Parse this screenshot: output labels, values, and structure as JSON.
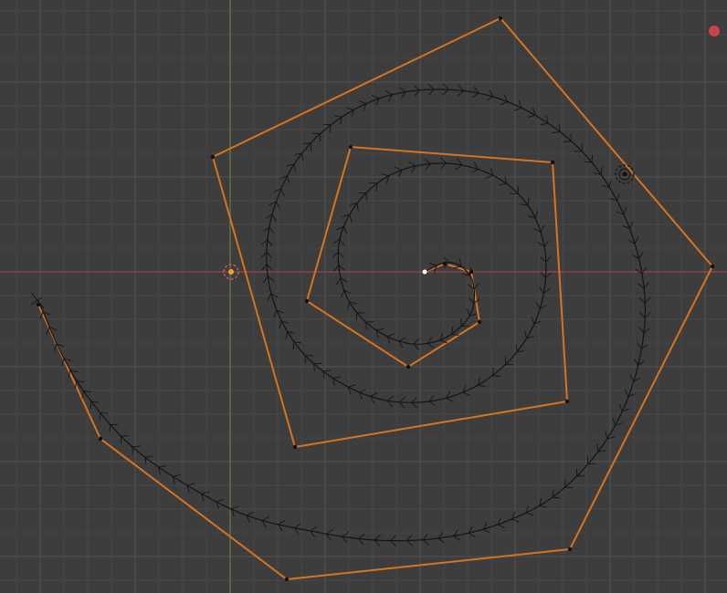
{
  "viewport": {
    "background_color": "#3d3d3d",
    "grid_minor_color": "#464646",
    "grid_major_color": "#525252",
    "x_axis_color": "#a84a4a",
    "y_axis_color": "#6b8a3a",
    "control_polygon_color": "#d7741f",
    "curve_color": "#141414",
    "vertex_color": "#111111",
    "active_vertex_color": "#ffffff",
    "origin_marker_color": "#f0a030",
    "cursor_color": "#e06060",
    "record_dot_color": "#c8434b"
  },
  "icons": {
    "origin": "object-origin-icon",
    "cursor": "3d-cursor-icon",
    "pivot": "pivot-point-icon",
    "record": "record-indicator-icon"
  }
}
